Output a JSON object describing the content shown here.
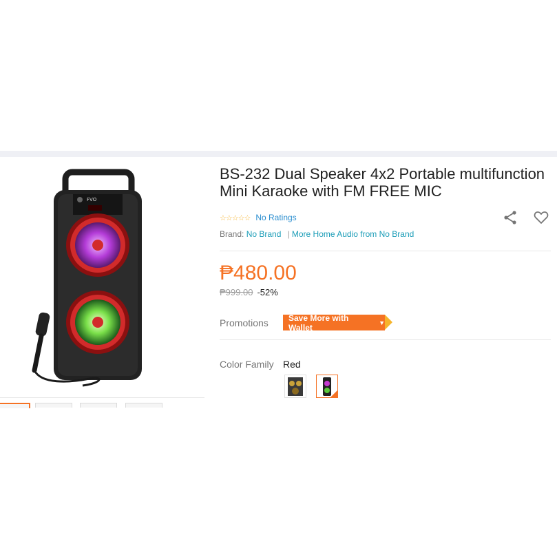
{
  "product": {
    "title": "BS-232 Dual Speaker 4x2 Portable multifunction Mini Karaoke with FM FREE MIC",
    "main_image_icon": "speaker-with-microphone-image",
    "thumbnails_count_visible": 4
  },
  "ratings": {
    "stars_icon": "empty-stars",
    "stars_text": "☆☆☆☆☆",
    "text": "No Ratings"
  },
  "brand": {
    "label": "Brand:",
    "value": "No Brand",
    "more_link": "More Home Audio from No Brand"
  },
  "actions": {
    "share_icon": "share-icon",
    "wishlist_icon": "heart-icon"
  },
  "price": {
    "current": "₱480.00",
    "original": "₱999.00",
    "discount": "-52%"
  },
  "promotions": {
    "label": "Promotions",
    "badge_text": "Save More with Wallet",
    "caret": "▼"
  },
  "variant": {
    "label": "Color Family",
    "selected_value": "Red",
    "swatches_count": 2
  },
  "colors": {
    "accent": "#f57224",
    "link": "#1a9cb7",
    "band": "#eff0f5",
    "promo_tail": "#f6b42c"
  }
}
